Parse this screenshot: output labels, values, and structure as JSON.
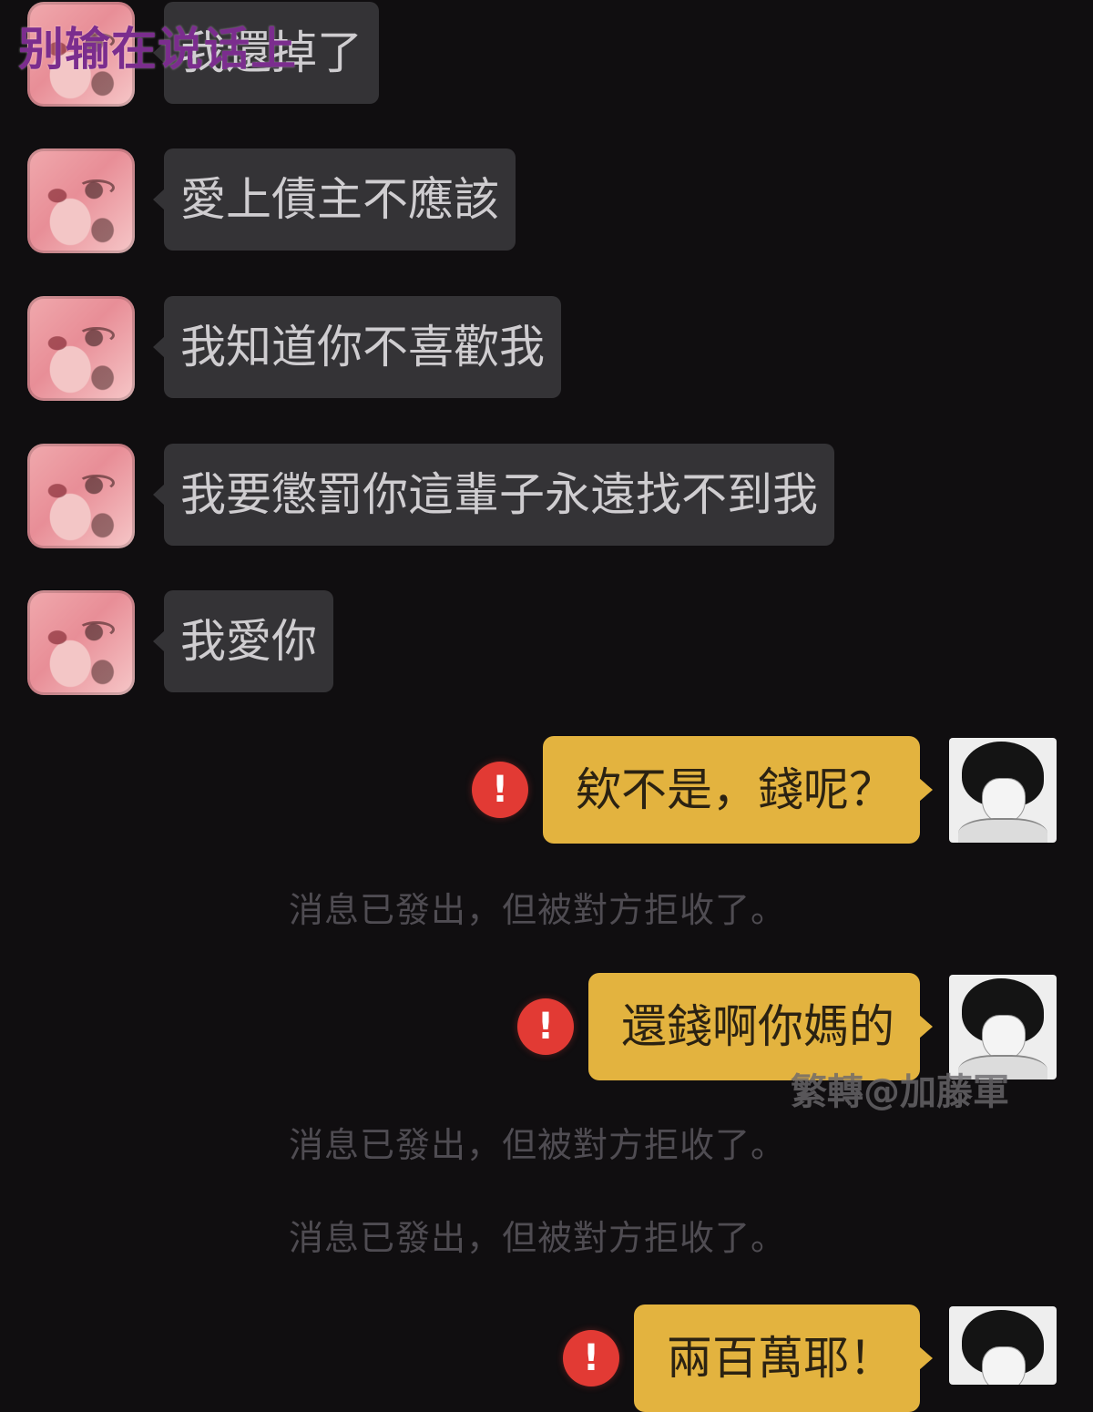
{
  "overlay": {
    "top_caption": "别输在说话上",
    "watermark": "繁轉@加藤軍"
  },
  "incoming_messages": [
    {
      "text": "我還掉了"
    },
    {
      "text": "愛上債主不應該"
    },
    {
      "text": "我知道你不喜歡我"
    },
    {
      "text": "我要懲罰你這輩子永遠找不到我"
    },
    {
      "text": "我愛你"
    }
  ],
  "outgoing_messages": [
    {
      "text": "欸不是，錢呢？",
      "status_icon": "!"
    },
    {
      "text": "還錢啊你媽的",
      "status_icon": "!"
    },
    {
      "text": "兩百萬耶！",
      "status_icon": "!"
    }
  ],
  "system_notes": [
    "消息已發出，但被對方拒收了。",
    "消息已發出，但被對方拒收了。",
    "消息已發出，但被對方拒收了。"
  ],
  "colors": {
    "background": "#100e10",
    "incoming_bubble": "#343336",
    "outgoing_bubble": "#e3b33f",
    "error_icon": "#e23a34",
    "caption": "#7b2d8e"
  }
}
